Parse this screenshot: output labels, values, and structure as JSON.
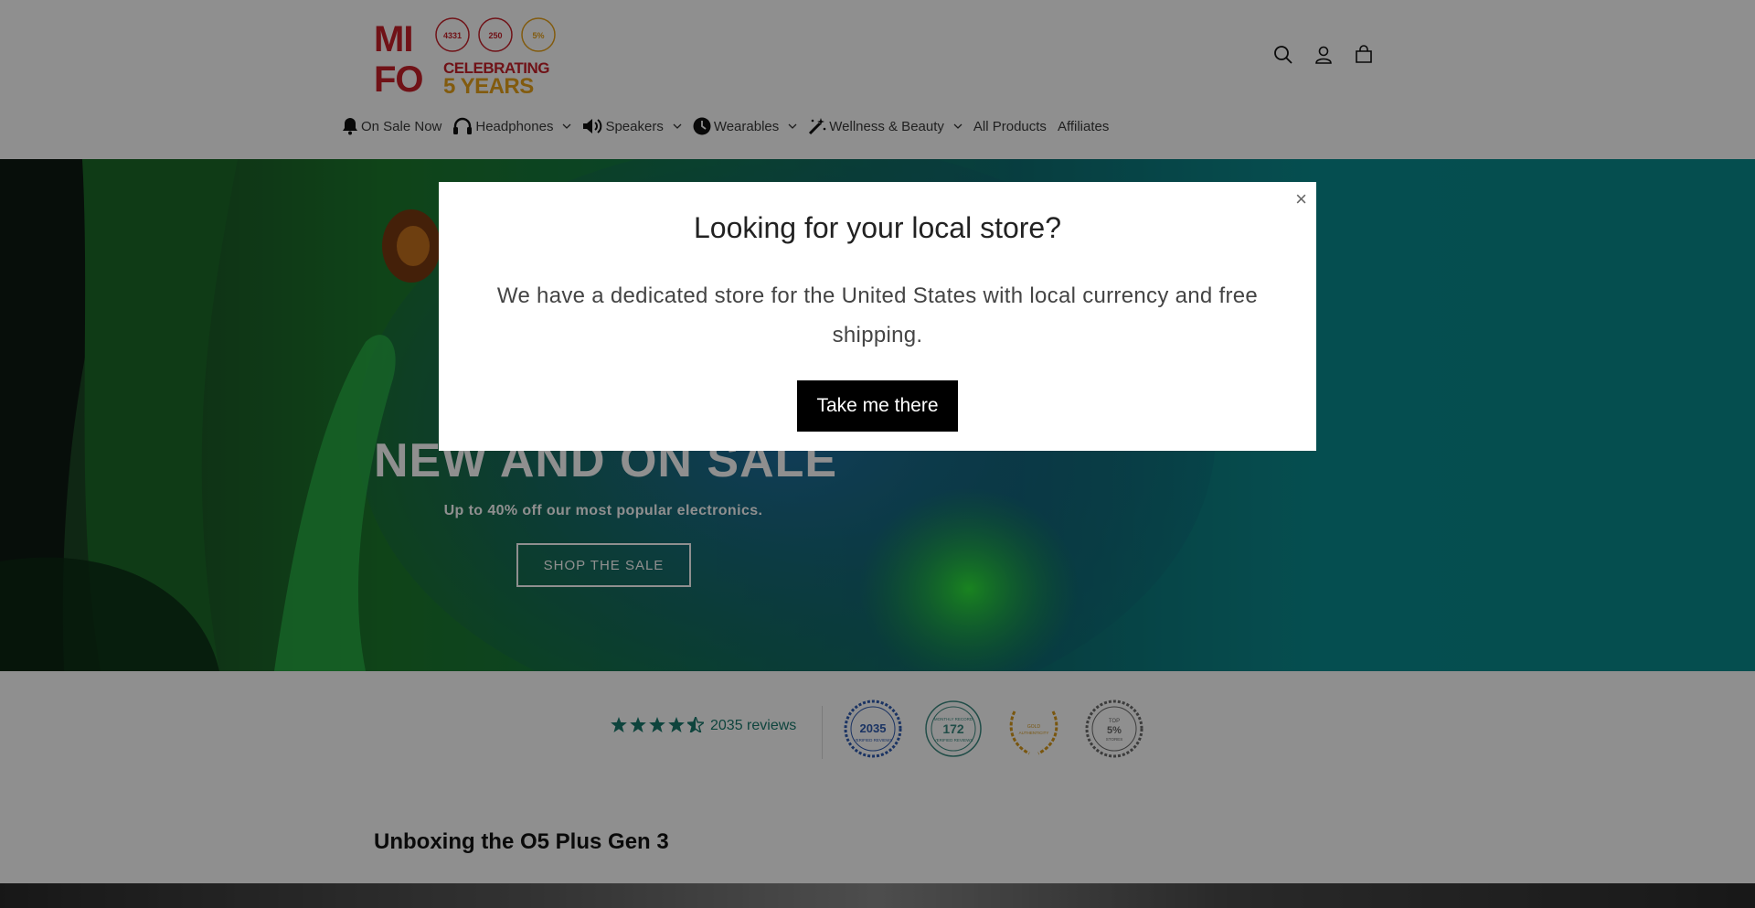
{
  "brand": {
    "logo_text_top": "MI",
    "logo_text_bottom": "FO",
    "logo_tagline_1": "CELEBRATING",
    "logo_tagline_2": "5 YEARS",
    "logo_badge_1": "4331",
    "logo_badge_2": "250",
    "logo_badge_3": "5%",
    "red": "#c8202a",
    "gold": "#e8a21a"
  },
  "header": {
    "icons": [
      "search-icon",
      "account-icon",
      "cart-icon"
    ]
  },
  "nav": {
    "items": [
      {
        "label": "On Sale Now",
        "icon": "bell-icon",
        "dropdown": false
      },
      {
        "label": "Headphones",
        "icon": "headphones-icon",
        "dropdown": true
      },
      {
        "label": "Speakers",
        "icon": "speaker-icon",
        "dropdown": true
      },
      {
        "label": "Wearables",
        "icon": "clock-icon",
        "dropdown": true
      },
      {
        "label": "Wellness & Beauty",
        "icon": "magic-wand-icon",
        "dropdown": true
      },
      {
        "label": "All Products",
        "icon": "",
        "dropdown": false
      },
      {
        "label": "Affiliates",
        "icon": "",
        "dropdown": false
      }
    ]
  },
  "hero": {
    "title": "NEW AND ON SALE",
    "subtitle": "Up to 40% off our most popular electronics.",
    "button_label": "SHOP THE SALE"
  },
  "reviews": {
    "rating": 4.5,
    "count_label": "2035 reviews",
    "star_color": "#1a7a6e",
    "badges": [
      {
        "name": "verified-reviews-badge",
        "number": "2035",
        "top": "",
        "bottom": "VERIFIED REVIEWS",
        "color": "#2f5bb0"
      },
      {
        "name": "monthly-record-badge",
        "number": "172",
        "top": "MONTHLY RECORD",
        "bottom": "VERIFIED REVIEWS",
        "color": "#3b8a80"
      },
      {
        "name": "gold-authenticity-badge",
        "number": "",
        "top": "GOLD",
        "bottom": "AUTHENTICITY",
        "color": "#d89a1c"
      },
      {
        "name": "top-stores-badge",
        "number": "5%",
        "top": "TOP",
        "bottom": "STORES",
        "color": "#6b6b6b"
      }
    ]
  },
  "section": {
    "title": "Unboxing the O5 Plus Gen 3"
  },
  "modal": {
    "close_label": "×",
    "title": "Looking for your local store?",
    "text": "We have a dedicated store for the United States with local currency and free shipping.",
    "button_label": "Take me there"
  }
}
